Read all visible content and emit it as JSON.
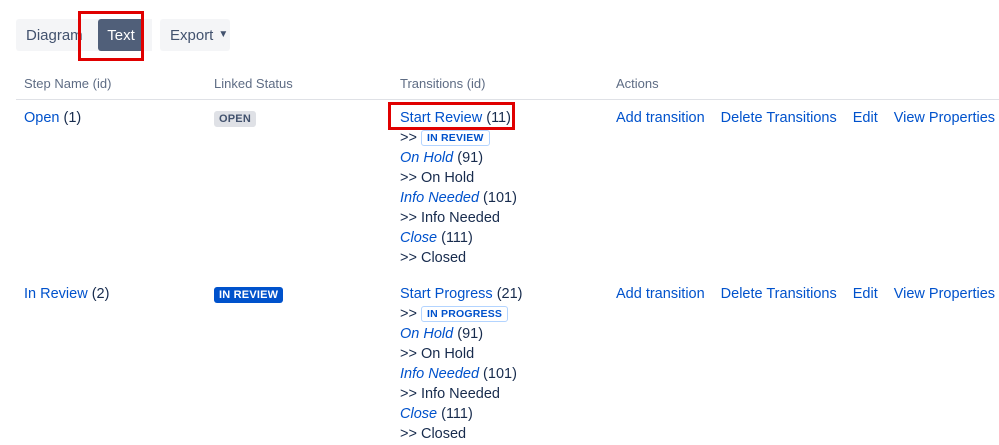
{
  "toolbar": {
    "diagram_label": "Diagram",
    "text_label": "Text",
    "export_label": "Export",
    "export_icon": "chevron-down-icon"
  },
  "columns": [
    "Step Name (id)",
    "Linked Status",
    "Transitions (id)",
    "Actions"
  ],
  "rows": [
    {
      "step_name": "Open",
      "step_id": "(1)",
      "status": "OPEN",
      "transitions": [
        {
          "name": "Start Review",
          "id": "(11)",
          "target": "IN REVIEW",
          "target_is_lozenge": true
        },
        {
          "name": "On Hold",
          "id": "(91)",
          "target": "On Hold",
          "target_is_lozenge": false
        },
        {
          "name": "Info Needed",
          "id": "(101)",
          "target": "Info Needed",
          "target_is_lozenge": false
        },
        {
          "name": "Close",
          "id": "(111)",
          "target": "Closed",
          "target_is_lozenge": false
        }
      ],
      "actions": [
        "Add transition",
        "Delete Transitions",
        "Edit",
        "View Properties"
      ]
    },
    {
      "step_name": "In Review",
      "step_id": "(2)",
      "status": "IN REVIEW",
      "transitions": [
        {
          "name": "Start Progress",
          "id": "(21)",
          "target": "IN PROGRESS",
          "target_is_lozenge": true
        },
        {
          "name": "On Hold",
          "id": "(91)",
          "target": "On Hold",
          "target_is_lozenge": false
        },
        {
          "name": "Info Needed",
          "id": "(101)",
          "target": "Info Needed",
          "target_is_lozenge": false
        },
        {
          "name": "Close",
          "id": "(111)",
          "target": "Closed",
          "target_is_lozenge": false
        }
      ],
      "actions": [
        "Add transition",
        "Delete Transitions",
        "Edit",
        "View Properties"
      ]
    }
  ],
  "arrow_prefix": ">>",
  "colors": {
    "link": "#0052cc",
    "highlight": "#e00000",
    "active_toggle": "#505f79"
  }
}
